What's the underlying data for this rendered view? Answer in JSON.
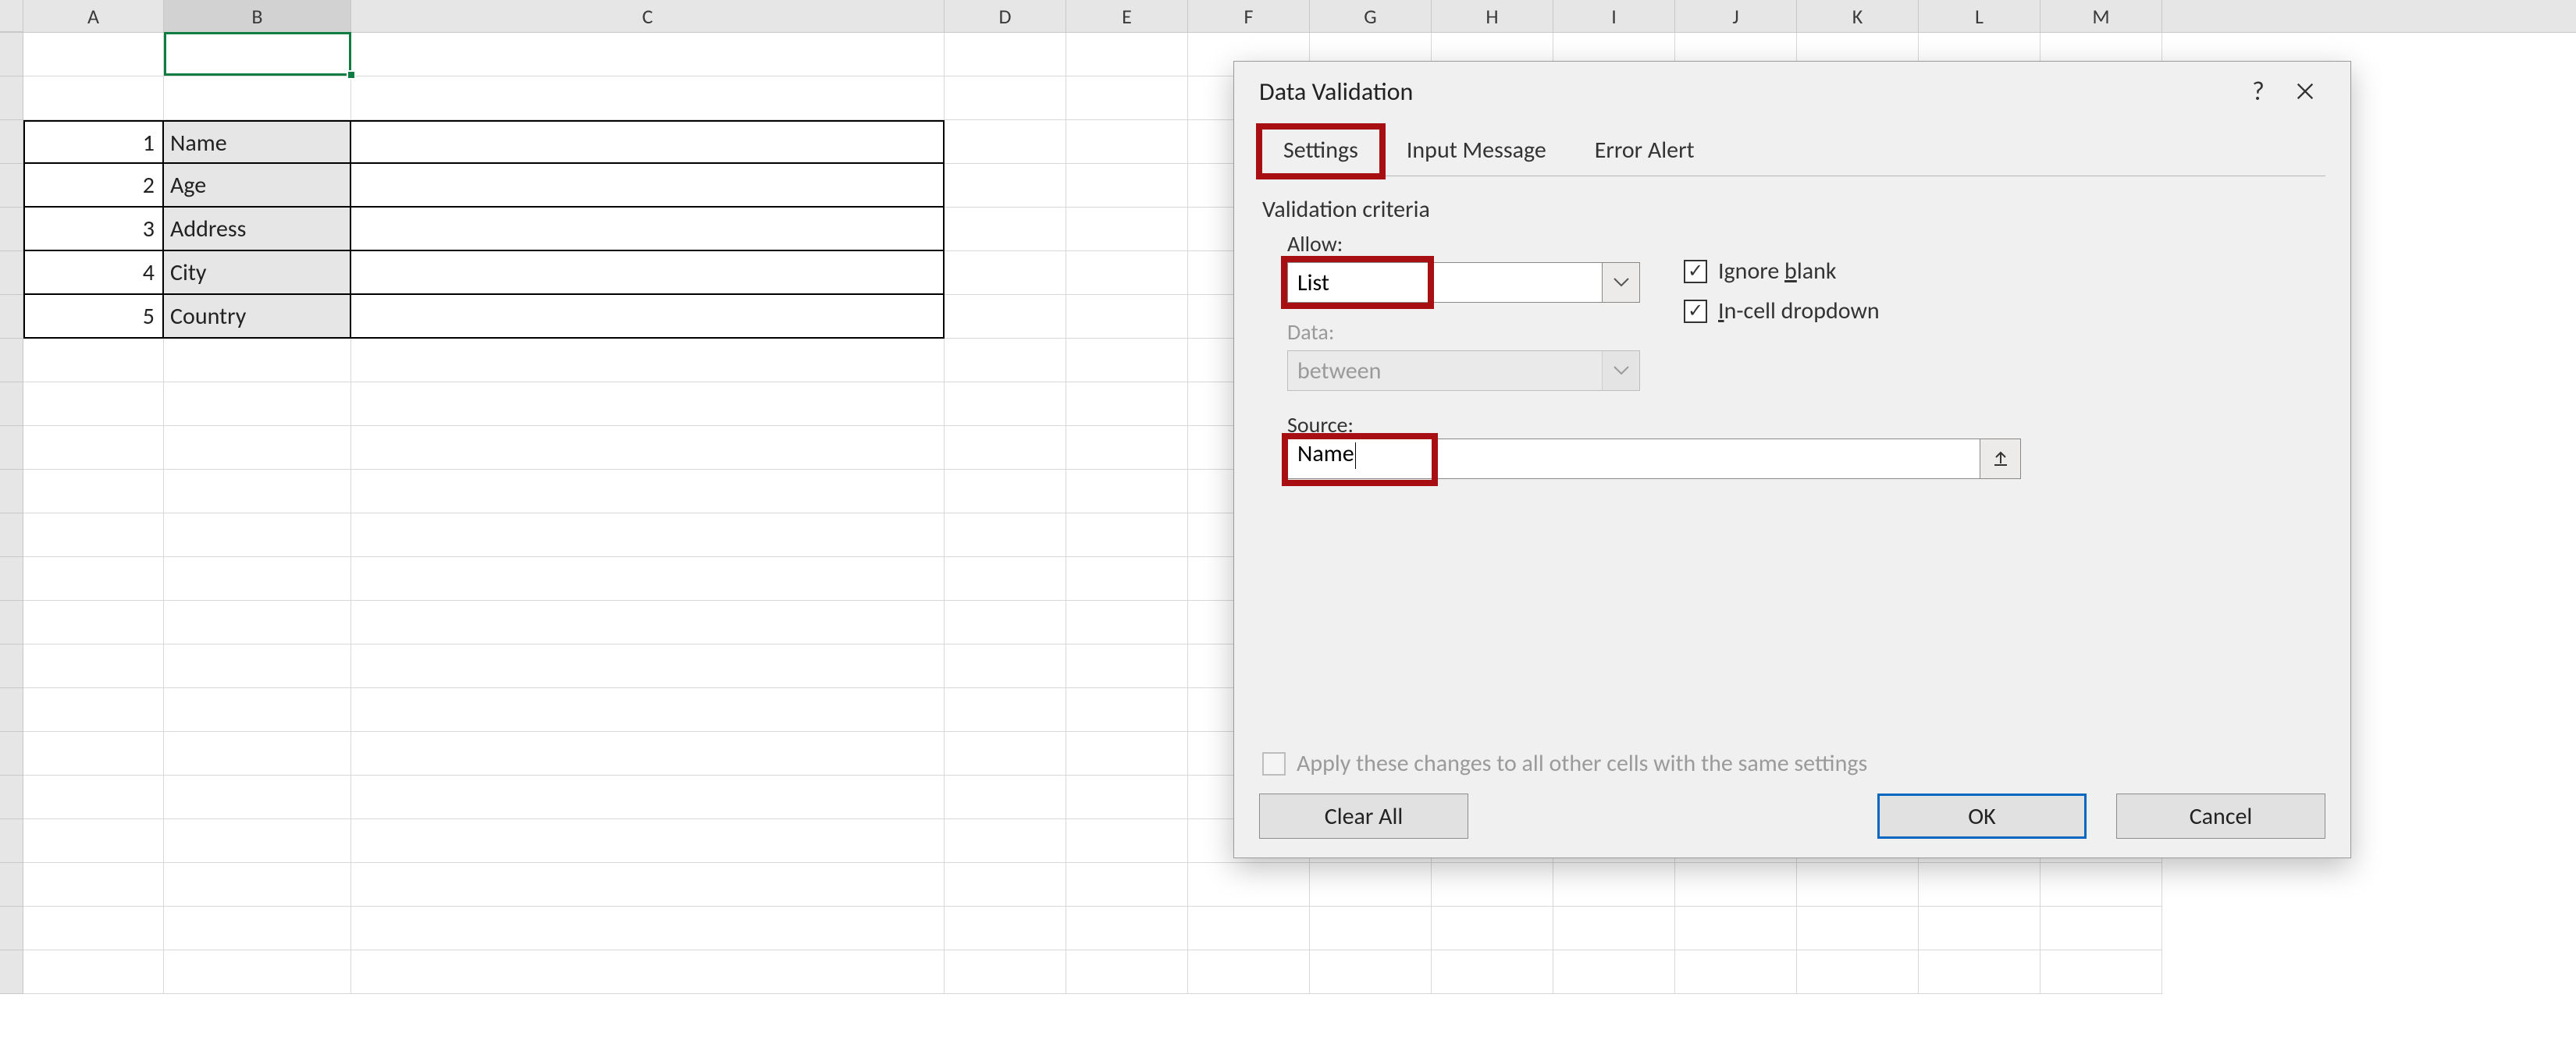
{
  "spreadsheet": {
    "columns": [
      "A",
      "B",
      "C",
      "D",
      "E",
      "F",
      "G",
      "H",
      "I",
      "J",
      "K",
      "L",
      "M"
    ],
    "selected_column": "B",
    "selected_cell": "B1",
    "data_rows": [
      {
        "num": "1",
        "label": "Name"
      },
      {
        "num": "2",
        "label": "Age"
      },
      {
        "num": "3",
        "label": "Address"
      },
      {
        "num": "4",
        "label": "City"
      },
      {
        "num": "5",
        "label": "Country"
      }
    ]
  },
  "dialog": {
    "title": "Data Validation",
    "help_tooltip": "?",
    "tabs": {
      "settings": "Settings",
      "input_message": "Input Message",
      "error_alert": "Error Alert"
    },
    "section_title": "Validation criteria",
    "allow_label": "Allow:",
    "allow_value": "List",
    "data_label": "Data:",
    "data_value": "between",
    "source_label": "Source:",
    "source_value": "Name",
    "ignore_blank_label_pre": "Ignore ",
    "ignore_blank_label_u": "b",
    "ignore_blank_label_post": "lank",
    "incell_label_pre": "",
    "incell_label_u": "I",
    "incell_label_post": "n-cell dropdown",
    "apply_label_pre": "Apply these changes to all other cells with the same settings",
    "apply_label_u": "",
    "clear_all": "Clear All",
    "ok": "OK",
    "cancel": "Cancel"
  }
}
